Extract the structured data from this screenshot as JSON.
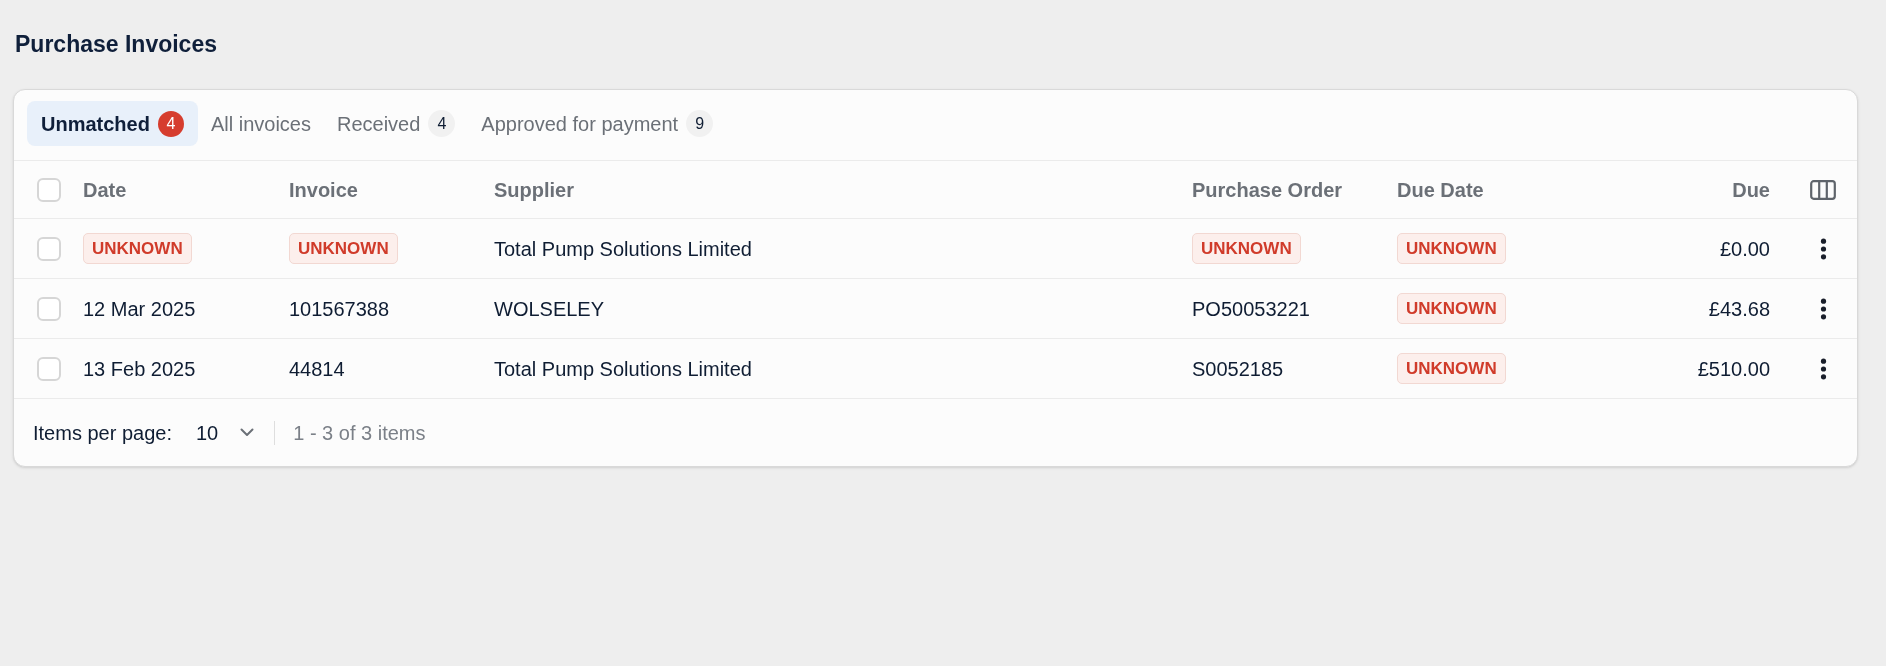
{
  "page_title": "Purchase Invoices",
  "tabs": [
    {
      "label": "Unmatched",
      "count": "4",
      "selected": true
    },
    {
      "label": "All invoices",
      "selected": false
    },
    {
      "label": "Received",
      "count": "4",
      "selected": false
    },
    {
      "label": "Approved for payment",
      "count": "9",
      "selected": false
    }
  ],
  "table": {
    "select_all_checked": false,
    "columns": [
      {
        "label": "Date",
        "kind": "text"
      },
      {
        "label": "Invoice",
        "kind": "text"
      },
      {
        "label": "Supplier",
        "kind": "text"
      },
      {
        "label": "Purchase Order",
        "kind": "text"
      },
      {
        "label": "Due Date",
        "kind": "text"
      },
      {
        "label": "Due",
        "kind": "amount"
      }
    ],
    "rows": [
      {
        "checked": false,
        "cells": [
          {
            "kind": "badge",
            "text": "UNKNOWN"
          },
          {
            "kind": "badge",
            "text": "UNKNOWN"
          },
          {
            "kind": "text",
            "text": "Total Pump Solutions Limited"
          },
          {
            "kind": "badge",
            "text": "UNKNOWN"
          },
          {
            "kind": "badge",
            "text": "UNKNOWN"
          },
          {
            "kind": "text",
            "text": "£0.00"
          }
        ]
      },
      {
        "checked": false,
        "cells": [
          {
            "kind": "text",
            "text": "12 Mar 2025"
          },
          {
            "kind": "text",
            "text": "101567388"
          },
          {
            "kind": "text",
            "text": "WOLSELEY"
          },
          {
            "kind": "text",
            "text": "PO50053221"
          },
          {
            "kind": "badge",
            "text": "UNKNOWN"
          },
          {
            "kind": "text",
            "text": "£43.68"
          }
        ]
      },
      {
        "checked": false,
        "cells": [
          {
            "kind": "text",
            "text": "13 Feb 2025"
          },
          {
            "kind": "text",
            "text": "44814"
          },
          {
            "kind": "text",
            "text": "Total Pump Solutions Limited"
          },
          {
            "kind": "text",
            "text": "S0052185"
          },
          {
            "kind": "badge",
            "text": "UNKNOWN"
          },
          {
            "kind": "text",
            "text": "£510.00"
          }
        ]
      }
    ]
  },
  "pagination": {
    "label": "Items per page:",
    "page_size": "10",
    "range": "1 - 3 of 3 items"
  }
}
